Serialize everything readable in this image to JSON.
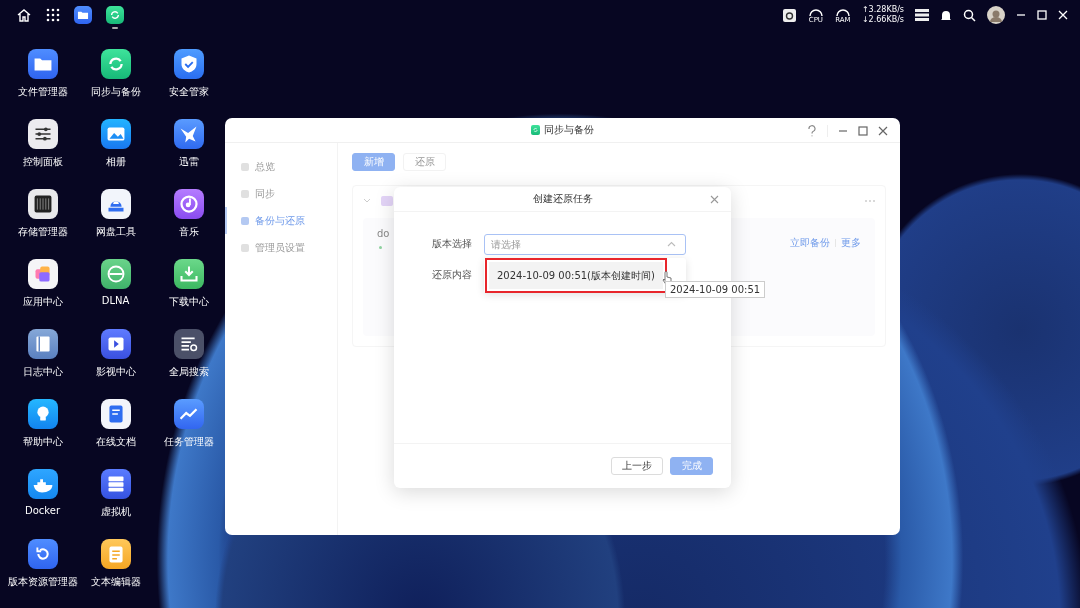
{
  "top_bar": {
    "running_apps": [
      {
        "kind": "files",
        "active": false
      },
      {
        "kind": "sync",
        "active": true
      }
    ],
    "monitor": {
      "cpu_label": "CPU",
      "ram_label": "RAM",
      "upload": "↑3.28KB/s",
      "download": "↓2.66KB/s"
    }
  },
  "desktop_icon_rows": [
    [
      {
        "label": "文件管理器",
        "kind": "folder"
      },
      {
        "label": "同步与备份",
        "kind": "sync"
      },
      {
        "label": "安全管家",
        "kind": "shield"
      }
    ],
    [
      {
        "label": "控制面板",
        "kind": "sliders"
      },
      {
        "label": "相册",
        "kind": "image"
      },
      {
        "label": "迅雷",
        "kind": "bird"
      }
    ],
    [
      {
        "label": "存储管理器",
        "kind": "storage"
      },
      {
        "label": "网盘工具",
        "kind": "cloud"
      },
      {
        "label": "音乐",
        "kind": "music"
      }
    ],
    [
      {
        "label": "应用中心",
        "kind": "apps"
      },
      {
        "label": "DLNA",
        "kind": "dlna"
      },
      {
        "label": "下载中心",
        "kind": "download"
      }
    ],
    [
      {
        "label": "日志中心",
        "kind": "log"
      },
      {
        "label": "影视中心",
        "kind": "video"
      },
      {
        "label": "全局搜索",
        "kind": "search"
      }
    ],
    [
      {
        "label": "帮助中心",
        "kind": "bulb"
      },
      {
        "label": "在线文档",
        "kind": "doc"
      },
      {
        "label": "任务管理器",
        "kind": "chart"
      }
    ],
    [
      {
        "label": "Docker",
        "kind": "whale"
      },
      {
        "label": "虚拟机",
        "kind": "server"
      }
    ],
    [
      {
        "label": "版本资源管理器",
        "kind": "restore"
      },
      {
        "label": "文本编辑器",
        "kind": "notepad"
      }
    ]
  ],
  "app_window": {
    "title": "同步与备份",
    "sidebar": [
      {
        "label": "总览",
        "selected": false
      },
      {
        "label": "同步",
        "selected": false
      },
      {
        "label": "备份与还原",
        "selected": true
      },
      {
        "label": "管理员设置",
        "selected": false
      }
    ],
    "toolbar_buttons": [
      {
        "label": "新增",
        "kind": "primary"
      },
      {
        "label": "还原",
        "kind": "default"
      }
    ],
    "card": {
      "name": "do",
      "actions": [
        "立即备份",
        "更多"
      ]
    }
  },
  "dialog": {
    "title": "创建还原任务",
    "fields": [
      {
        "label": "版本选择",
        "placeholder": "请选择",
        "expanded": true
      },
      {
        "label": "还原内容"
      }
    ],
    "options": [
      {
        "label": "2024-10-09 00:51(版本创建时间)",
        "highlighted": true
      }
    ],
    "tooltip": "2024-10-09 00:51",
    "buttons": [
      {
        "label": "上一步",
        "kind": "default",
        "disabled": false
      },
      {
        "label": "完成",
        "kind": "primary",
        "disabled": true
      }
    ]
  }
}
